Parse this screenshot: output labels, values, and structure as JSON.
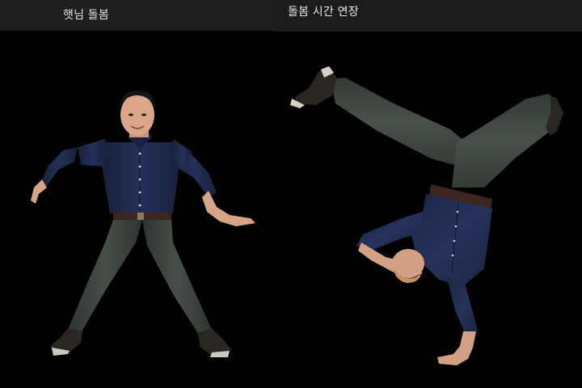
{
  "panels": [
    {
      "caption": "햇님 돌봄"
    },
    {
      "caption": "돌봄 시간 연장"
    }
  ],
  "colors": {
    "background": "#000000",
    "caption_bar": "#1e1e1e",
    "caption_text": "#e6e6e6",
    "shirt": "#1f2a4a",
    "pants": "#3d433f",
    "skin": "#d9a688",
    "shoes": "#2a2622"
  }
}
